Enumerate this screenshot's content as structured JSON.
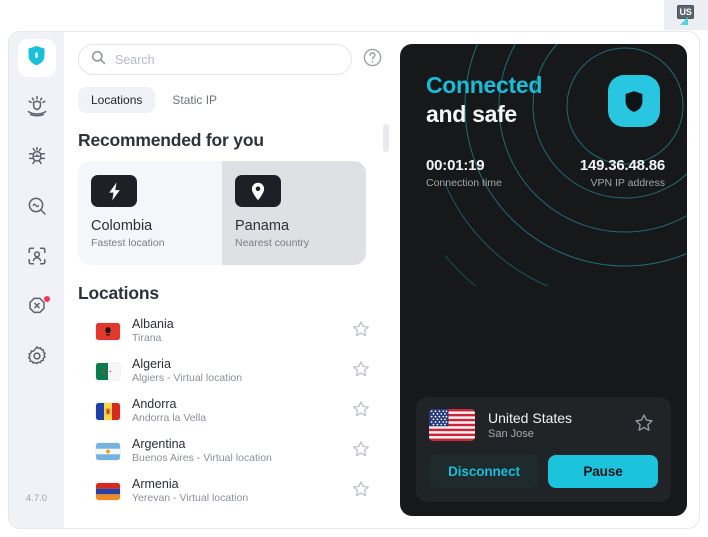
{
  "tray": {
    "keyboard_layout": "US",
    "icon": "keyboard-layout-icon"
  },
  "app": {
    "version": "4.7.0"
  },
  "sidebar": {
    "items": [
      {
        "name": "vpn",
        "icon": "shield-icon",
        "active": true,
        "badge": false
      },
      {
        "name": "threat-protection",
        "icon": "threat-protection-icon",
        "active": false,
        "badge": false
      },
      {
        "name": "malware-scan",
        "icon": "bug-icon",
        "active": false,
        "badge": false
      },
      {
        "name": "dark-web-monitor",
        "icon": "magnifier-wave-icon",
        "active": false,
        "badge": false
      },
      {
        "name": "identity",
        "icon": "person-scan-icon",
        "active": false,
        "badge": false
      },
      {
        "name": "blocker",
        "icon": "octagon-x-icon",
        "active": false,
        "badge": true
      },
      {
        "name": "settings",
        "icon": "gear-icon",
        "active": false,
        "badge": false
      }
    ]
  },
  "search": {
    "value": "",
    "placeholder": "Search",
    "icon": "search-icon"
  },
  "help": {
    "icon": "help-circle-icon"
  },
  "tabs": [
    {
      "label": "Locations",
      "active": true
    },
    {
      "label": "Static IP",
      "active": false
    }
  ],
  "recommended": {
    "heading": "Recommended for you",
    "cards": [
      {
        "title": "Colombia",
        "subtitle": "Fastest location",
        "icon": "lightning-bolt-icon",
        "hover": false
      },
      {
        "title": "Panama",
        "subtitle": "Nearest country",
        "icon": "map-pin-icon",
        "hover": true
      }
    ]
  },
  "locations": {
    "heading": "Locations",
    "star_icon": "star-outline-icon",
    "items": [
      {
        "country": "Albania",
        "city": "Tirana",
        "flag": "flag-albania"
      },
      {
        "country": "Algeria",
        "city": "Algiers - Virtual location",
        "flag": "flag-algeria"
      },
      {
        "country": "Andorra",
        "city": "Andorra la Vella",
        "flag": "flag-andorra"
      },
      {
        "country": "Argentina",
        "city": "Buenos Aires - Virtual location",
        "flag": "flag-argentina"
      },
      {
        "country": "Armenia",
        "city": "Yerevan - Virtual location",
        "flag": "flag-armenia"
      }
    ]
  },
  "status_panel": {
    "title_line1": "Connected",
    "title_line2": "and safe",
    "shield_icon": "shield-icon",
    "stats": [
      {
        "value": "00:01:19",
        "label": "Connection time"
      },
      {
        "value": "149.36.48.86",
        "label": "VPN IP address"
      }
    ]
  },
  "connection_card": {
    "country": "United States",
    "city": "San Jose",
    "flag": "flag-united-states",
    "star_icon": "star-outline-icon",
    "buttons": [
      {
        "label": "Disconnect",
        "style": "secondary"
      },
      {
        "label": "Pause",
        "style": "primary"
      }
    ]
  },
  "colors": {
    "accent": "#1cc3dd",
    "accent_text": "#17bdd9",
    "panel_dark": "#16181a",
    "card_dark": "#212427",
    "sidebar_bg": "#f1f2f7",
    "badge_red": "#f3375b"
  }
}
